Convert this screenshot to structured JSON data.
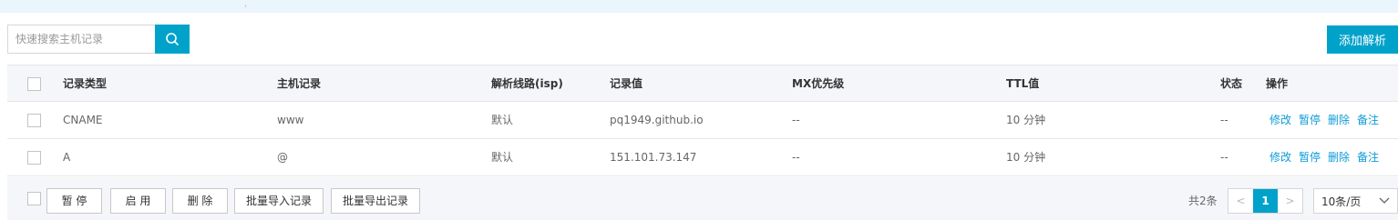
{
  "toolbar": {
    "search_placeholder": "快速搜索主机记录",
    "add_button": "添加解析"
  },
  "table": {
    "columns": [
      "记录类型",
      "主机记录",
      "解析线路(isp)",
      "记录值",
      "MX优先级",
      "TTL值",
      "状态",
      "操作"
    ],
    "rows": [
      {
        "type": "CNAME",
        "host": "www",
        "line": "默认",
        "value": "pq1949.github.io",
        "mx": "--",
        "ttl": "10 分钟",
        "status": "--"
      },
      {
        "type": "A",
        "host": "@",
        "line": "默认",
        "value": "151.101.73.147",
        "mx": "--",
        "ttl": "10 分钟",
        "status": "--"
      }
    ],
    "row_actions": [
      "修改",
      "暂停",
      "删除",
      "备注"
    ]
  },
  "footer": {
    "buttons": [
      "暂 停",
      "启 用",
      "删 除",
      "批量导入记录",
      "批量导出记录"
    ],
    "total": "共2条",
    "current_page": "1",
    "prev": "<",
    "next": ">",
    "page_size": "10条/页"
  },
  "icons": {
    "search": "search-icon",
    "chevron": "chevron-down-icon"
  },
  "colors": {
    "accent": "#00a2ca",
    "link": "#0d9bd7",
    "banner": "#eaf5fc",
    "header_bg": "#f5f6fa"
  }
}
